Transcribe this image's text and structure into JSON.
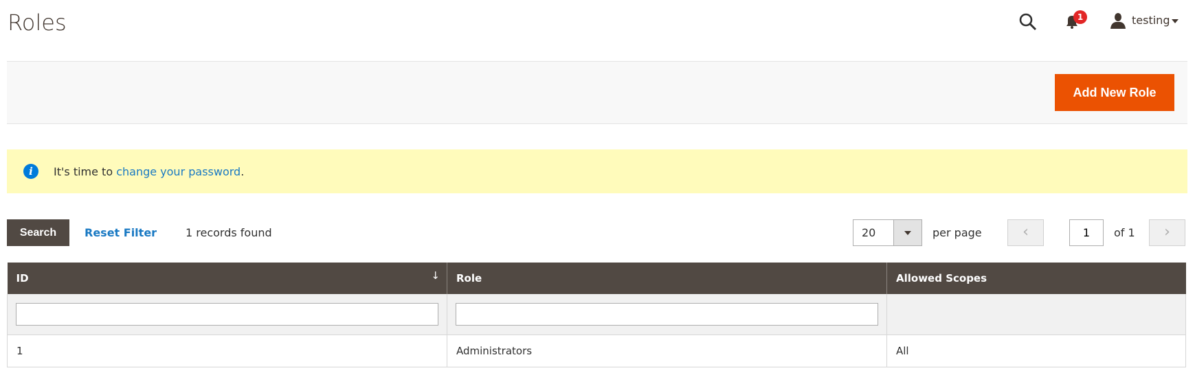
{
  "header": {
    "title": "Roles",
    "notification_count": "1",
    "user": "testing"
  },
  "actions": {
    "add_new_role": "Add New Role"
  },
  "notice": {
    "prefix": "It's time to ",
    "link": "change your password",
    "suffix": "."
  },
  "toolbar": {
    "search": "Search",
    "reset_filter": "Reset Filter",
    "records_found": "1 records found",
    "per_page_value": "20",
    "per_page_label": "per page",
    "prev": "‹",
    "next": "›",
    "page": "1",
    "of_pages": "of 1"
  },
  "grid": {
    "columns": [
      "ID",
      "Role",
      "Allowed Scopes"
    ],
    "sort_indicator": "↓",
    "rows": [
      {
        "id": "1",
        "role": "Administrators",
        "scopes": "All"
      }
    ]
  },
  "colors": {
    "accent": "#eb5202",
    "header_bg": "#514943",
    "notice_bg": "#fffbbb",
    "link": "#1979c3"
  }
}
